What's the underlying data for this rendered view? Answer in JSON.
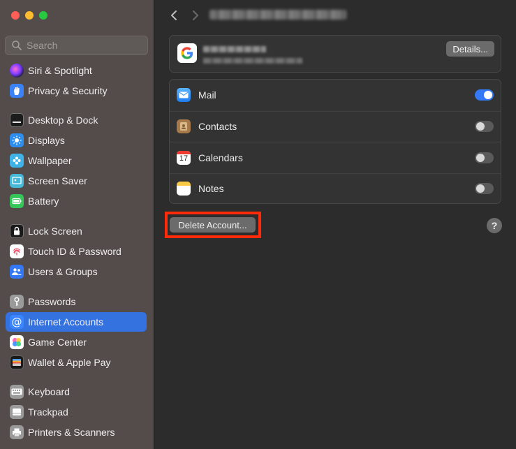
{
  "sidebar": {
    "search_placeholder": "Search",
    "items": [
      {
        "label": "Siri & Spotlight",
        "icon": "siri-icon"
      },
      {
        "label": "Privacy & Security",
        "icon": "hand-icon"
      },
      {
        "label": "Desktop & Dock",
        "icon": "dock-icon"
      },
      {
        "label": "Displays",
        "icon": "sun-icon"
      },
      {
        "label": "Wallpaper",
        "icon": "flower-icon"
      },
      {
        "label": "Screen Saver",
        "icon": "screensaver-icon"
      },
      {
        "label": "Battery",
        "icon": "battery-icon"
      },
      {
        "label": "Lock Screen",
        "icon": "lock-icon"
      },
      {
        "label": "Touch ID & Password",
        "icon": "fingerprint-icon"
      },
      {
        "label": "Users & Groups",
        "icon": "users-icon"
      },
      {
        "label": "Passwords",
        "icon": "key-icon"
      },
      {
        "label": "Internet Accounts",
        "icon": "at-icon",
        "selected": true
      },
      {
        "label": "Game Center",
        "icon": "game-center-icon"
      },
      {
        "label": "Wallet & Apple Pay",
        "icon": "wallet-icon"
      },
      {
        "label": "Keyboard",
        "icon": "keyboard-icon"
      },
      {
        "label": "Trackpad",
        "icon": "trackpad-icon"
      },
      {
        "label": "Printers & Scanners",
        "icon": "printer-icon"
      }
    ]
  },
  "account": {
    "details_label": "Details..."
  },
  "services": [
    {
      "label": "Mail",
      "enabled": true,
      "icon": "mail-icon"
    },
    {
      "label": "Contacts",
      "enabled": false,
      "icon": "contacts-icon"
    },
    {
      "label": "Calendars",
      "enabled": false,
      "icon": "calendar-icon",
      "calendar_day": "17"
    },
    {
      "label": "Notes",
      "enabled": false,
      "icon": "notes-icon"
    }
  ],
  "actions": {
    "delete_label": "Delete Account...",
    "help_label": "?"
  },
  "colors": {
    "accent": "#3472e0",
    "highlight_frame": "#ff2a0a"
  }
}
